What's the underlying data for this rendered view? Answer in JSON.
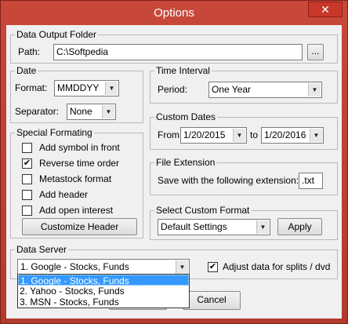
{
  "window": {
    "title": "Options",
    "close_glyph": "✕"
  },
  "data_output_folder": {
    "title": "Data Output Folder",
    "path_label": "Path:",
    "path_value": "C:\\Softpedia",
    "browse_label": "..."
  },
  "date": {
    "title": "Date",
    "format_label": "Format:",
    "format_value": "MMDDYY",
    "separator_label": "Separator:",
    "separator_value": "None"
  },
  "special_formating": {
    "title": "Special Formating",
    "options": [
      {
        "label": "Add symbol in front",
        "checked": false
      },
      {
        "label": "Reverse time order",
        "checked": true
      },
      {
        "label": "Metastock format",
        "checked": false
      },
      {
        "label": "Add header",
        "checked": false
      },
      {
        "label": "Add open interest",
        "checked": false
      }
    ],
    "customize_button": "Customize Header"
  },
  "time_interval": {
    "title": "Time Interval",
    "period_label": "Period:",
    "period_value": "One Year"
  },
  "custom_dates": {
    "title": "Custom Dates",
    "from_label": "From:",
    "from_value": "1/20/2015",
    "to_label": "to",
    "to_value": "1/20/2016"
  },
  "file_extension": {
    "title": "File Extension",
    "label": "Save with the following extension:",
    "value": ".txt"
  },
  "select_custom_format": {
    "title": "Select Custom Format",
    "value": "Default Settings",
    "apply_label": "Apply"
  },
  "data_server": {
    "title": "Data Server",
    "value": "1. Google - Stocks, Funds",
    "options": [
      "1. Google - Stocks, Funds",
      "2. Yahoo - Stocks, Funds",
      "3. MSN - Stocks, Funds"
    ],
    "adjust_label": "Adjust data for splits / dvd",
    "adjust_checked": true
  },
  "buttons": {
    "cancel_label": "Cancel"
  }
}
